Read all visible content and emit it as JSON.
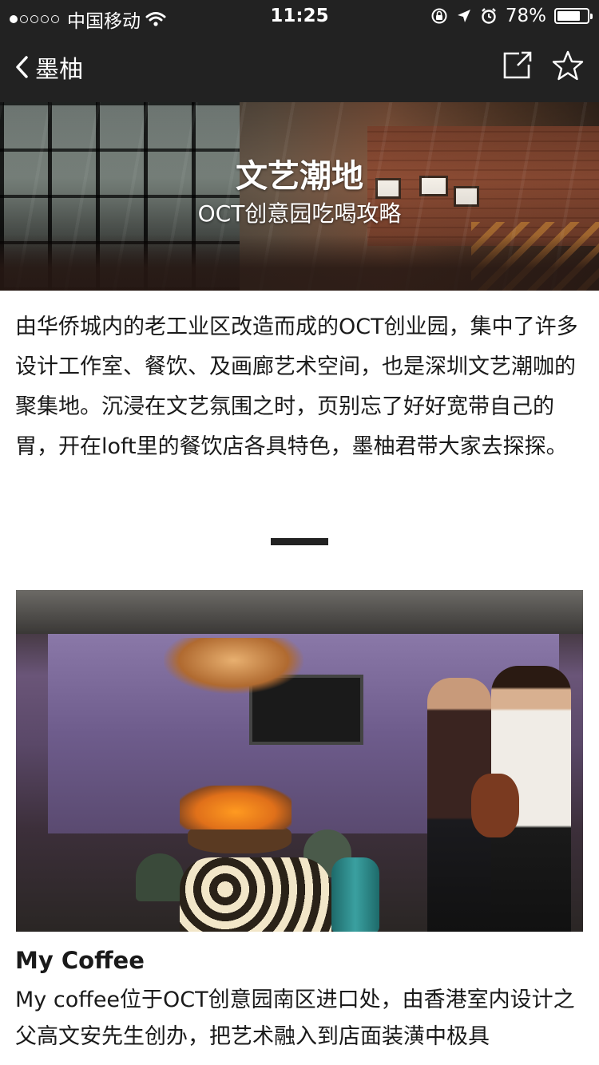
{
  "status_bar": {
    "carrier": "中国移动",
    "time": "11:25",
    "battery": "78%",
    "battery_level": 0.78,
    "signal_bars": 1,
    "signal_total": 5
  },
  "nav": {
    "back_label": "墨柚",
    "icons": [
      "back-chevron-icon",
      "share-icon",
      "star-icon"
    ]
  },
  "hero": {
    "title": "文艺潮地",
    "subtitle": "OCT创意园吃喝攻略"
  },
  "intro": {
    "text": "由华侨城内的老工业区改造而成的OCT创业园，集中了许多设计工作室、餐饮、及画廊艺术空间，也是深圳文艺潮咖的聚集地。沉浸在文艺氛围之时，页别忘了好好宽带自己的胃，开在loft里的餐饮店各具特色，墨柚君带大家去探探。"
  },
  "section": {
    "title": "My Coffee",
    "body": "My coffee位于OCT创意园南区进口处，由香港室内设计之父高文安先生创办，把艺术融入到店面装潢中极具"
  },
  "colors": {
    "bar_background": "#222222",
    "text": "#1a1a1a",
    "background": "#ffffff"
  }
}
